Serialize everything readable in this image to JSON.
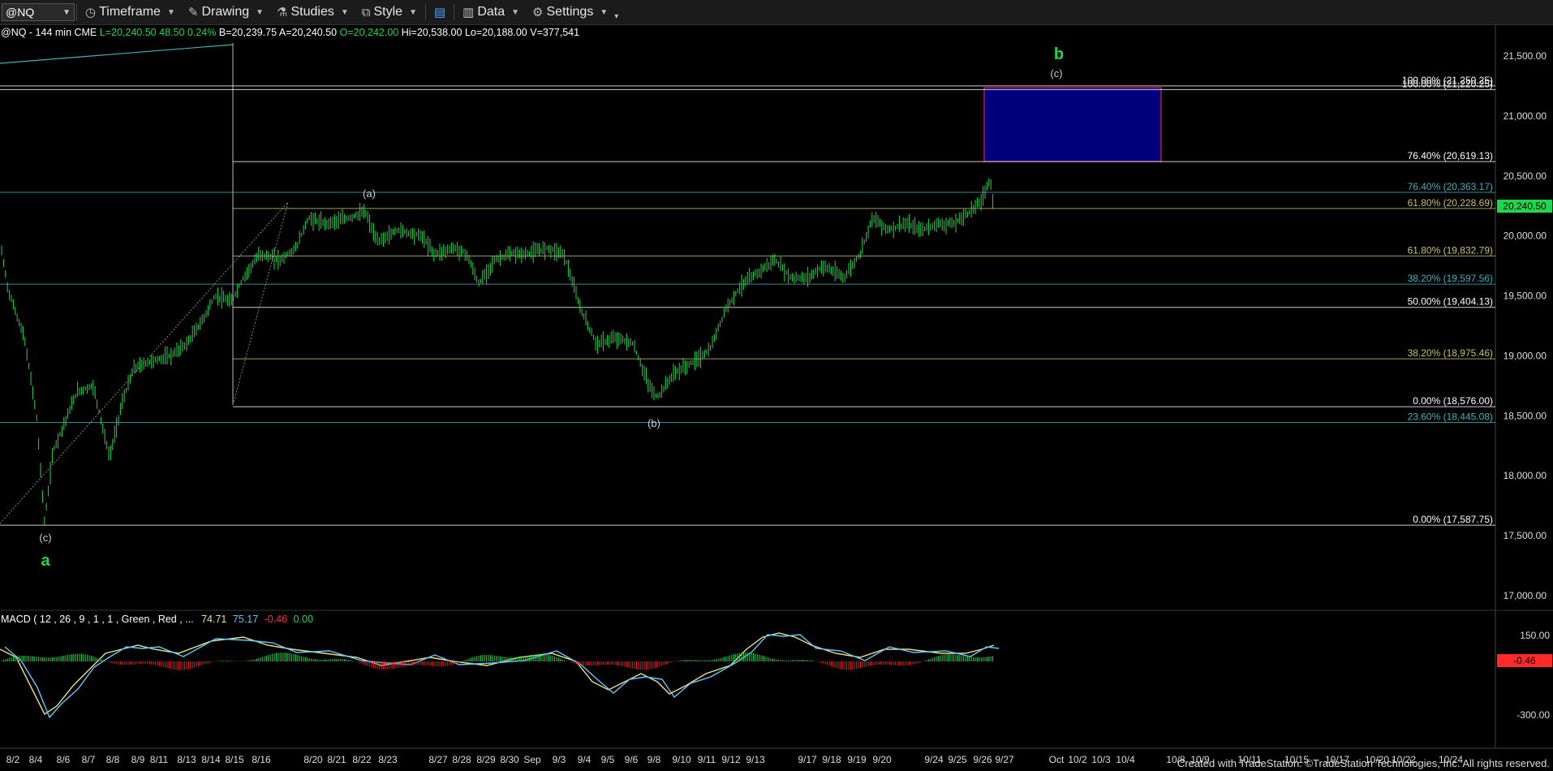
{
  "toolbar": {
    "symbol": "@NQ",
    "items": [
      "Timeframe",
      "Drawing",
      "Studies",
      "Style",
      "Data",
      "Settings"
    ]
  },
  "info": {
    "symbol_desc": "@NQ - 144 min  CME",
    "last": "L=20,240.50",
    "change": "48.50",
    "pct": "0.24%",
    "bid": "B=20,239.75",
    "ask": "A=20,240.50",
    "open": "O=20,242.00",
    "high": "Hi=20,538.00",
    "low": "Lo=20,188.00",
    "volume": "V=377,541"
  },
  "price_axis": {
    "labels": [
      "21,500.00",
      "21,000.00",
      "20,500.00",
      "20,000.00",
      "19,500.00",
      "19,000.00",
      "18,500.00",
      "18,000.00",
      "17,500.00",
      "17,000.00"
    ],
    "last_price": "20,240.50"
  },
  "macd": {
    "label_prefix": "MACD ( 12 , 26 , 9 , 1 , 1 , Green , Red , ...",
    "v1": "74.71",
    "v2": "75.17",
    "v3": "-0.46",
    "v4": "0.00",
    "axis": [
      "150.00",
      "-300.00"
    ],
    "hist_value": "-0.46"
  },
  "fib_levels": [
    {
      "text": "100.00% (21,250.25)",
      "price": 21250.25,
      "color": "#ffffff"
    },
    {
      "text": "100.00% (21,220.25)",
      "price": 21220.25,
      "color": "#ffffff"
    },
    {
      "text": "76.40% (20,619.13)",
      "price": 20619.13,
      "color": "#ffffff"
    },
    {
      "text": "76.40% (20,363.17)",
      "price": 20363.17,
      "color": "#3fb0b8"
    },
    {
      "text": "61.80% (20,228.69)",
      "price": 20228.69,
      "color": "#c8c070"
    },
    {
      "text": "61.80% (19,832.79)",
      "price": 19832.79,
      "color": "#c8c070"
    },
    {
      "text": "38.20% (19,597.56)",
      "price": 19597.56,
      "color": "#3fb0b8"
    },
    {
      "text": "50.00% (19,404.13)",
      "price": 19404.13,
      "color": "#ffffff"
    },
    {
      "text": "38.20% (18,975.46)",
      "price": 18975.46,
      "color": "#c8c070"
    },
    {
      "text": "0.00% (18,576.00)",
      "price": 18576.0,
      "color": "#ffffff"
    },
    {
      "text": "23.60% (18,445.08)",
      "price": 18445.08,
      "color": "#3fb0b8"
    },
    {
      "text": "0.00% (17,587.75)",
      "price": 17587.75,
      "color": "#ffffff"
    }
  ],
  "wave_labels": {
    "a_paren": "(a)",
    "b_paren": "(b)",
    "c_paren_top": "(c)",
    "c_paren_bottom": "(c)",
    "big_a": "a",
    "big_b": "b"
  },
  "date_axis": [
    "8/2",
    "8/4",
    "8/6",
    "8/7",
    "8/8",
    "8/9",
    "8/11",
    "8/13",
    "8/14",
    "8/15",
    "8/16",
    "8/20",
    "8/21",
    "8/22",
    "8/23",
    "8/27",
    "8/28",
    "8/29",
    "8/30",
    "Sep",
    "9/3",
    "9/4",
    "9/5",
    "9/6",
    "9/8",
    "9/10",
    "9/11",
    "9/12",
    "9/13",
    "9/17",
    "9/18",
    "9/19",
    "9/20",
    "9/24",
    "9/25",
    "9/26",
    "9/27",
    "Oct",
    "10/2",
    "10/3",
    "10/4",
    "10/8",
    "10/9",
    "10/11",
    "10/15",
    "10/17",
    "10/20",
    "10/22",
    "10/24"
  ],
  "footer": "Created with TradeStation. ©TradeStation Technologies, Inc. All rights reserved.",
  "colors": {
    "bars": "#21d64a",
    "box": "#00007c",
    "box_border": "#e0204a",
    "wave_green": "#21d64a"
  }
}
